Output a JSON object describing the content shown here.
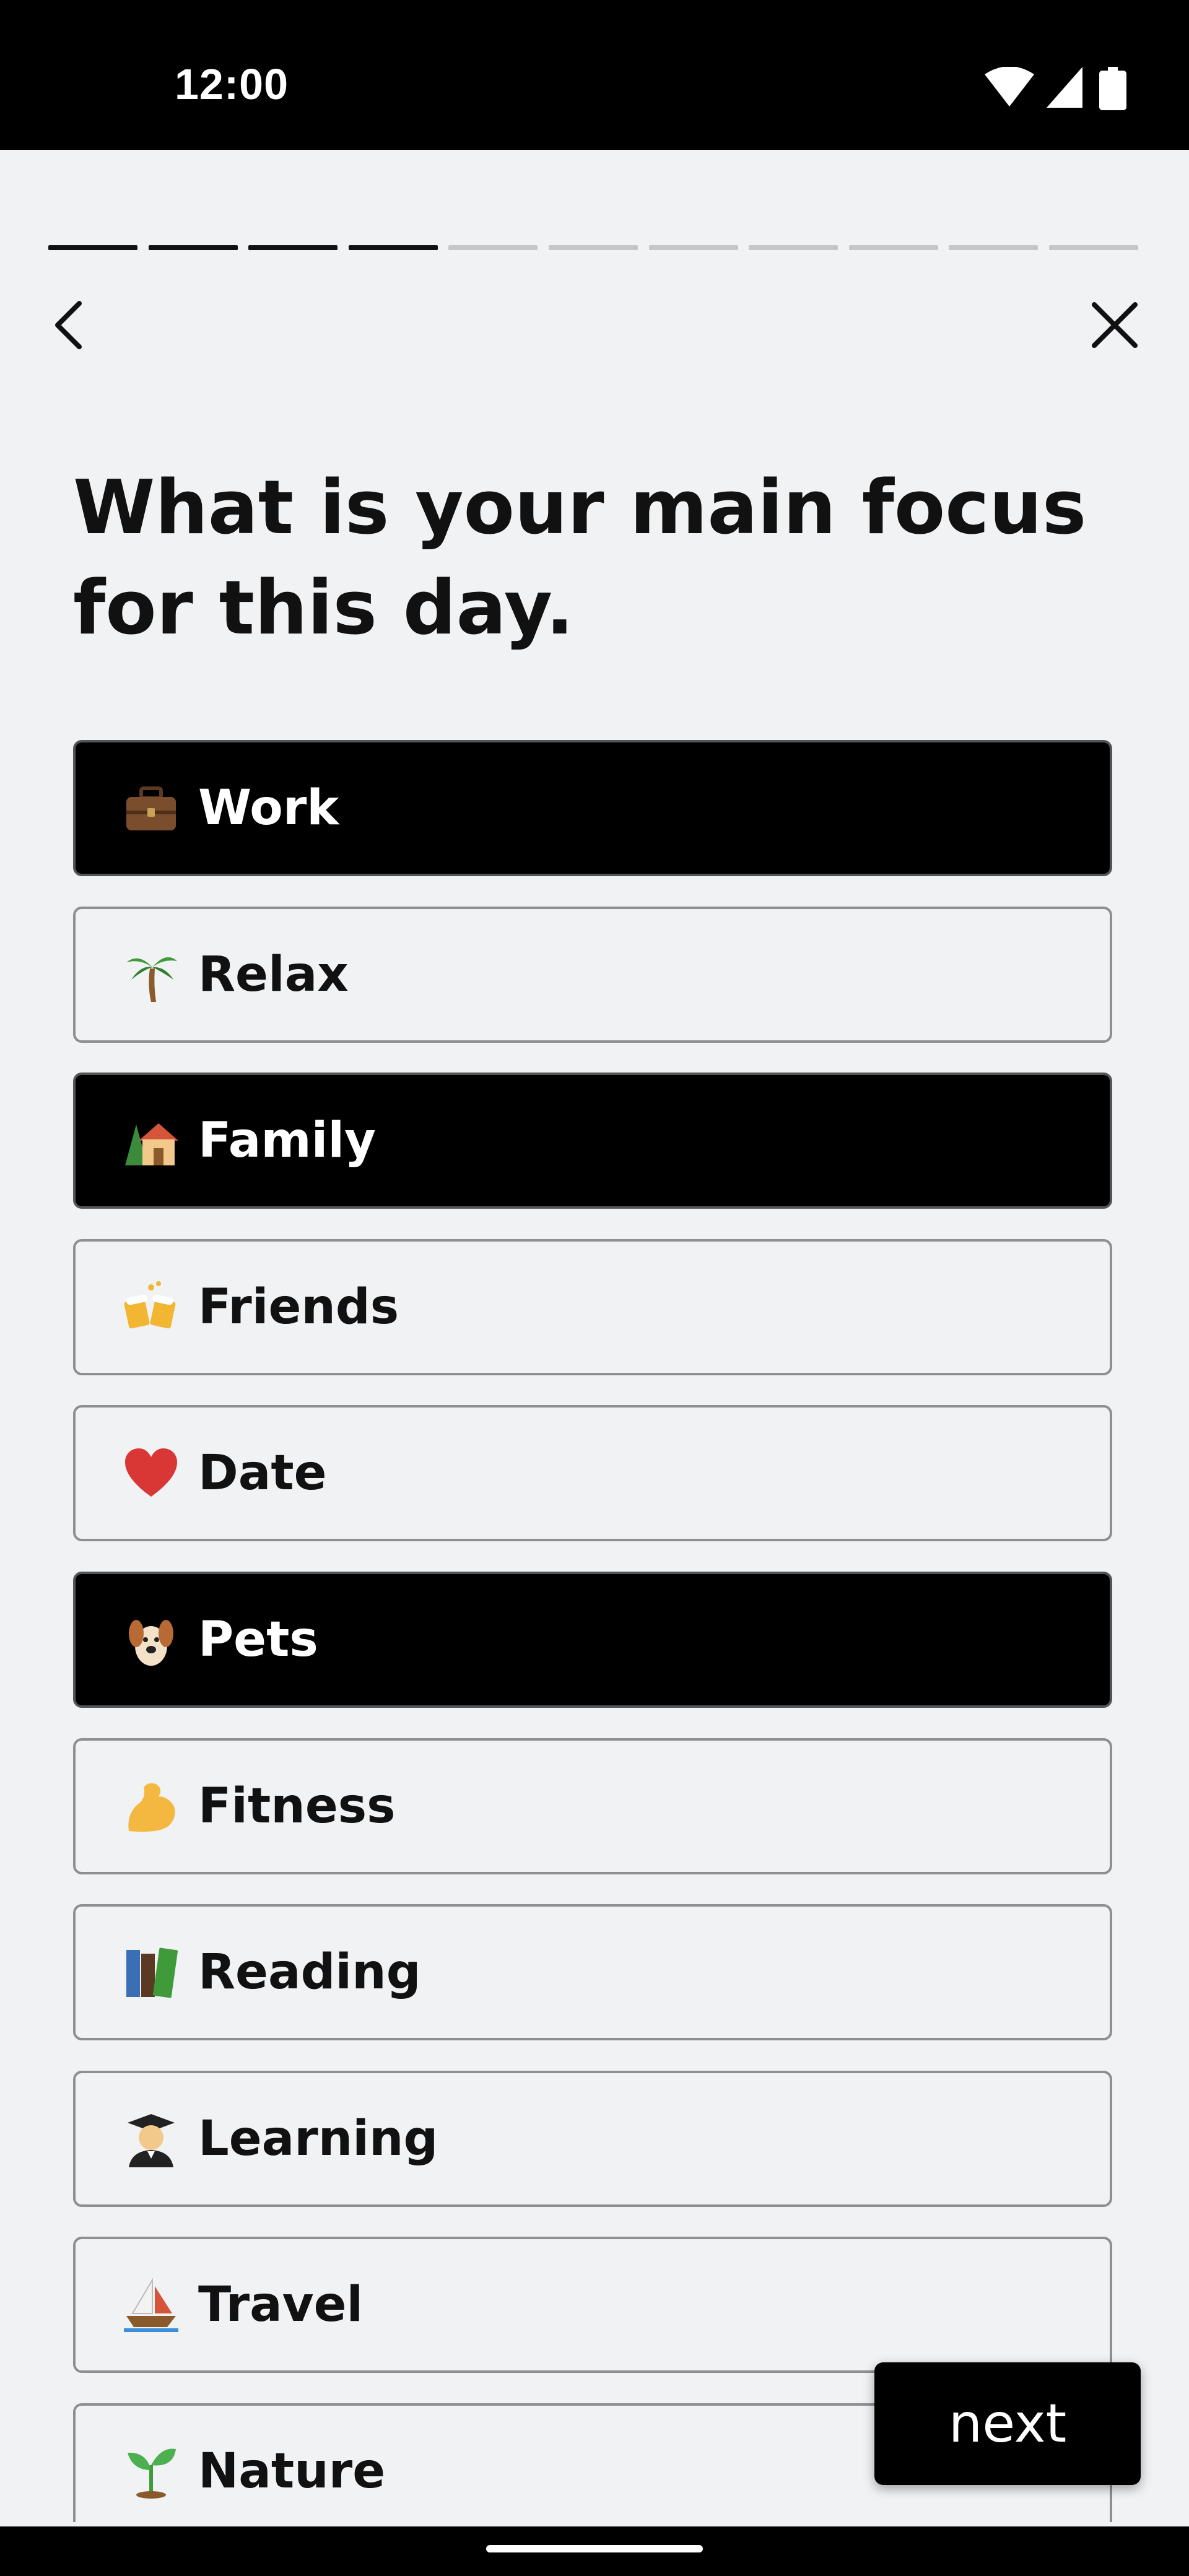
{
  "status_bar": {
    "time": "12:00",
    "icons": [
      "wifi-icon",
      "signal-icon",
      "battery-icon"
    ]
  },
  "progress": {
    "total_steps": 11,
    "completed_steps": 4
  },
  "nav": {
    "back_icon": "chevron-left-icon",
    "close_icon": "close-icon"
  },
  "title": "What is your main focus for this day.",
  "options": [
    {
      "label": "Work",
      "icon": "briefcase-icon",
      "selected": true
    },
    {
      "label": "Relax",
      "icon": "palm-tree-icon",
      "selected": false
    },
    {
      "label": "Family",
      "icon": "house-icon",
      "selected": true
    },
    {
      "label": "Friends",
      "icon": "beer-mugs-icon",
      "selected": false
    },
    {
      "label": "Date",
      "icon": "heart-icon",
      "selected": false
    },
    {
      "label": "Pets",
      "icon": "dog-icon",
      "selected": true
    },
    {
      "label": "Fitness",
      "icon": "flexed-biceps-icon",
      "selected": false
    },
    {
      "label": "Reading",
      "icon": "books-icon",
      "selected": false
    },
    {
      "label": "Learning",
      "icon": "graduate-icon",
      "selected": false
    },
    {
      "label": "Travel",
      "icon": "sailboat-icon",
      "selected": false
    },
    {
      "label": "Nature",
      "icon": "seedling-icon",
      "selected": false
    }
  ],
  "next_button": {
    "label": "next"
  },
  "colors": {
    "background": "#f1f2f4",
    "selected": "#000000",
    "border": "#8d8f93",
    "progress_done": "#111111",
    "progress_todo": "#c4c6ca"
  }
}
